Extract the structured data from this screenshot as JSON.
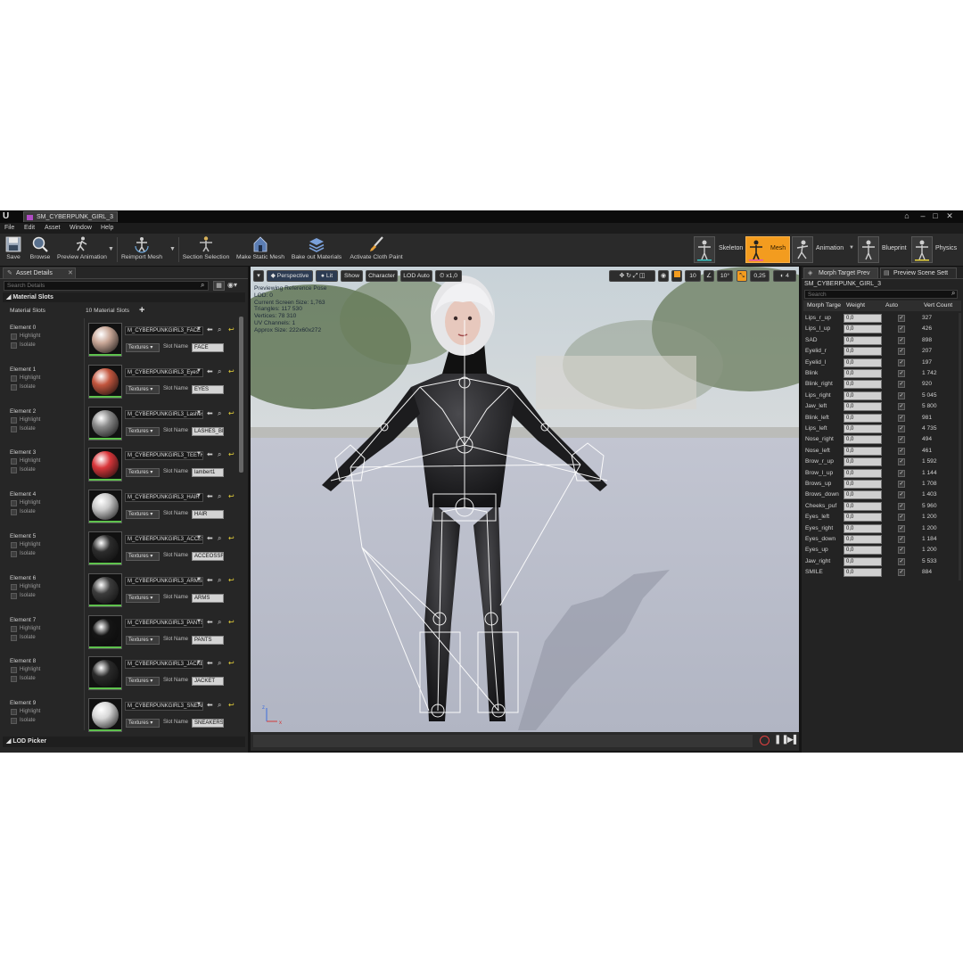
{
  "window": {
    "tab_title": "SM_CYBERPUNK_GIRL_3"
  },
  "menu": [
    "File",
    "Edit",
    "Asset",
    "Window",
    "Help"
  ],
  "toolbar": {
    "save": "Save",
    "browse": "Browse",
    "preview_animation": "Preview Animation",
    "reimport_mesh": "Reimport Mesh",
    "section_selection": "Section Selection",
    "make_static_mesh": "Make Static Mesh",
    "bake_out_materials": "Bake out Materials",
    "activate_cloth_paint": "Activate Cloth Paint"
  },
  "modes": {
    "skeleton": "Skeleton",
    "mesh": "Mesh",
    "animation": "Animation",
    "blueprint": "Blueprint",
    "physics": "Physics",
    "active_color": "#f39c1f"
  },
  "left_panel": {
    "tab": "Asset Details",
    "search_placeholder": "Search Details",
    "category": "Material Slots",
    "slots_label": "Material Slots",
    "slots_count": "10 Material Slots",
    "highlight_label": "Highlight",
    "isolate_label": "Isolate",
    "textures_label": "Textures",
    "slot_name_label": "Slot Name",
    "lod_picker": "LOD Picker",
    "elements": [
      {
        "name": "Element 0",
        "material": "M_CYBERPUNKGIRL3_FACE",
        "slot": "FACE",
        "color": "#c9a797"
      },
      {
        "name": "Element 1",
        "material": "M_CYBERPUNKGIRL3_Eyes",
        "slot": "EYES",
        "color": "#c3563e"
      },
      {
        "name": "Element 2",
        "material": "M_CYBERPUNKGIRL3_Lashes",
        "slot": "LASHES_BF",
        "color": "#8a8a8a"
      },
      {
        "name": "Element 3",
        "material": "M_CYBERPUNKGIRL3_TEETH",
        "slot": "lambert1",
        "color": "#d9363a"
      },
      {
        "name": "Element 4",
        "material": "M_CYBERPUNKGIRL3_HAIR",
        "slot": "HAIR",
        "color": "#c9c9c9"
      },
      {
        "name": "Element 5",
        "material": "M_CYBERPUNKGIRL3_ACCESSOR",
        "slot": "ACCEOSSR",
        "color": "#2c2c2c"
      },
      {
        "name": "Element 6",
        "material": "M_CYBERPUNKGIRL3_ARMS",
        "slot": "ARMS",
        "color": "#3c3c3c"
      },
      {
        "name": "Element 7",
        "material": "M_CYBERPUNKGIRL3_PANTS",
        "slot": "PANTS",
        "color": "#151515"
      },
      {
        "name": "Element 8",
        "material": "M_CYBERPUNKGIRL3_JACKET",
        "slot": "JACKET",
        "color": "#2a2a2a"
      },
      {
        "name": "Element 9",
        "material": "M_CYBERPUNKGIRL3_SNEAKERS",
        "slot": "SNEAKERS",
        "color": "#d7d7d7"
      }
    ]
  },
  "viewport": {
    "perspective": "Perspective",
    "lit": "Lit",
    "show": "Show",
    "character": "Character",
    "lod_auto": "LOD Auto",
    "speed": "x1,0",
    "grid_snap": "10",
    "angle_snap": "10°",
    "scale_snap": "0,25",
    "camera_speed": "4",
    "stats": [
      "Previewing Reference Pose",
      "LOD: 0",
      "Current Screen Size: 1,763",
      "Triangles: 117 530",
      "Vertices: 78 310",
      "UV Channels: 1",
      "Approx Size: 222x60x272"
    ]
  },
  "right_panel": {
    "tab_morph": "Morph Target Prev",
    "tab_scene": "Preview Scene Sett",
    "asset_name": "SM_CYBERPUNK_GIRL_3",
    "search_placeholder": "Search",
    "col_morph": "Morph Targe",
    "col_weight": "Weight",
    "col_auto": "Auto",
    "col_vert": "Vert Count",
    "check_glyph": "✓",
    "rows": [
      {
        "name": "Lips_r_up",
        "weight": "0,0",
        "vert": "327"
      },
      {
        "name": "Lips_l_up",
        "weight": "0,0",
        "vert": "426"
      },
      {
        "name": "SAD",
        "weight": "0,0",
        "vert": "898"
      },
      {
        "name": "Eyelid_r",
        "weight": "0,0",
        "vert": "207"
      },
      {
        "name": "Eyelid_l",
        "weight": "0,0",
        "vert": "197"
      },
      {
        "name": "Blink",
        "weight": "0,0",
        "vert": "1 742"
      },
      {
        "name": "Blink_right",
        "weight": "0,0",
        "vert": "920"
      },
      {
        "name": "Lips_right",
        "weight": "0,0",
        "vert": "5 045"
      },
      {
        "name": "Jaw_left",
        "weight": "0,0",
        "vert": "5 800"
      },
      {
        "name": "Blink_left",
        "weight": "0,0",
        "vert": "981"
      },
      {
        "name": "Lips_left",
        "weight": "0,0",
        "vert": "4 735"
      },
      {
        "name": "Nose_right",
        "weight": "0,0",
        "vert": "494"
      },
      {
        "name": "Nose_left",
        "weight": "0,0",
        "vert": "461"
      },
      {
        "name": "Brow_r_up",
        "weight": "0,0",
        "vert": "1 592"
      },
      {
        "name": "Brow_l_up",
        "weight": "0,0",
        "vert": "1 144"
      },
      {
        "name": "Brows_up",
        "weight": "0,0",
        "vert": "1 708"
      },
      {
        "name": "Brows_down",
        "weight": "0,0",
        "vert": "1 403"
      },
      {
        "name": "Cheeks_puf",
        "weight": "0,0",
        "vert": "5 960"
      },
      {
        "name": "Eyes_left",
        "weight": "0,0",
        "vert": "1 200"
      },
      {
        "name": "Eyes_right",
        "weight": "0,0",
        "vert": "1 200"
      },
      {
        "name": "Eyes_down",
        "weight": "0,0",
        "vert": "1 184"
      },
      {
        "name": "Eyes_up",
        "weight": "0,0",
        "vert": "1 200"
      },
      {
        "name": "Jaw_right",
        "weight": "0,0",
        "vert": "5 533"
      },
      {
        "name": "SMILE",
        "weight": "0,0",
        "vert": "884"
      }
    ]
  }
}
